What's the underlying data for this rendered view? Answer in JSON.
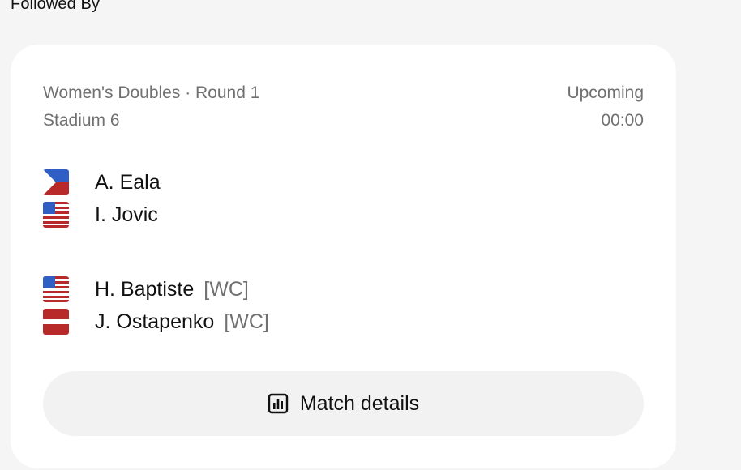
{
  "section": {
    "title": "Followed By"
  },
  "match": {
    "event": "Women's Doubles · Round 1",
    "court": "Stadium 6",
    "status": "Upcoming",
    "time": "00:00",
    "teams": [
      {
        "players": [
          {
            "name": "A. Eala",
            "flag_icon": "philippines-flag-icon",
            "seed": ""
          },
          {
            "name": "I. Jovic",
            "flag_icon": "usa-flag-icon",
            "seed": ""
          }
        ]
      },
      {
        "players": [
          {
            "name": "H. Baptiste",
            "flag_icon": "usa-flag-icon",
            "seed": "[WC]"
          },
          {
            "name": "J. Ostapenko",
            "flag_icon": "latvia-flag-icon",
            "seed": "[WC]"
          }
        ]
      }
    ],
    "details_button": {
      "label": "Match details",
      "icon": "bar-chart-icon"
    }
  },
  "colors": {
    "background": "#f5f5f5",
    "card": "#ffffff",
    "muted_text": "#707070",
    "button_bg": "#f2f2f2",
    "flag_blue": "#2f5fc4",
    "flag_red": "#b82a2a"
  }
}
